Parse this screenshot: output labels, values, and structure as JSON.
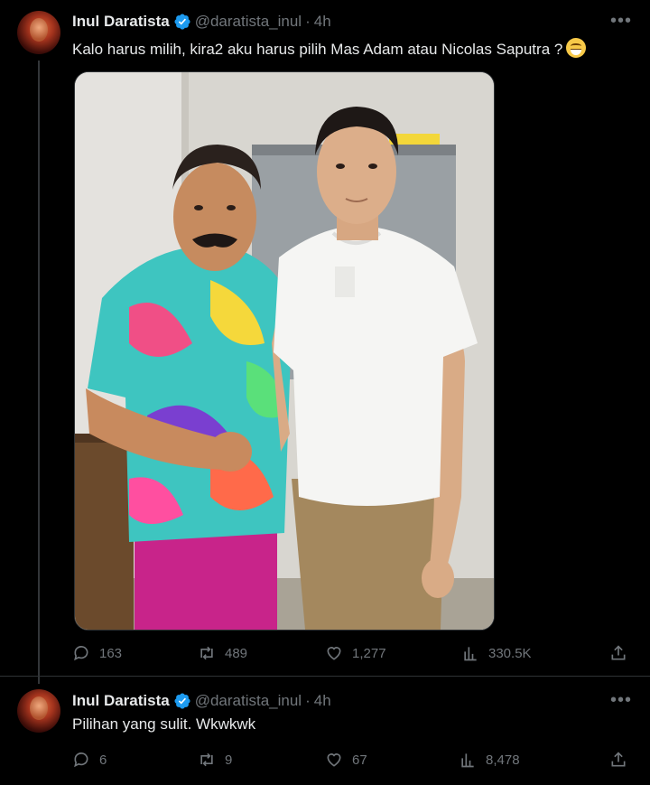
{
  "tweet1": {
    "author_name": "Inul Daratista",
    "author_handle": "@daratista_inul",
    "separator": "·",
    "time": "4h",
    "text": "Kalo harus milih, kira2 aku harus pilih Mas Adam atau Nicolas Saputra ?",
    "emoji": "grinning-sweat-emoji",
    "stats": {
      "replies": "163",
      "reposts": "489",
      "likes": "1,277",
      "views": "330.5K"
    }
  },
  "tweet2": {
    "author_name": "Inul Daratista",
    "author_handle": "@daratista_inul",
    "separator": "·",
    "time": "4h",
    "text": "Pilihan yang sulit. Wkwkwk",
    "stats": {
      "replies": "6",
      "reposts": "9",
      "likes": "67",
      "views": "8,478"
    }
  },
  "icons": {
    "more": "more-icon",
    "reply": "reply-icon",
    "repost": "repost-icon",
    "like": "heart-icon",
    "views": "views-icon",
    "share": "share-icon",
    "verified": "verified-badge-icon"
  },
  "colors": {
    "background": "#000000",
    "text": "#e7e9ea",
    "muted": "#71767b",
    "verified": "#1d9bf0"
  }
}
